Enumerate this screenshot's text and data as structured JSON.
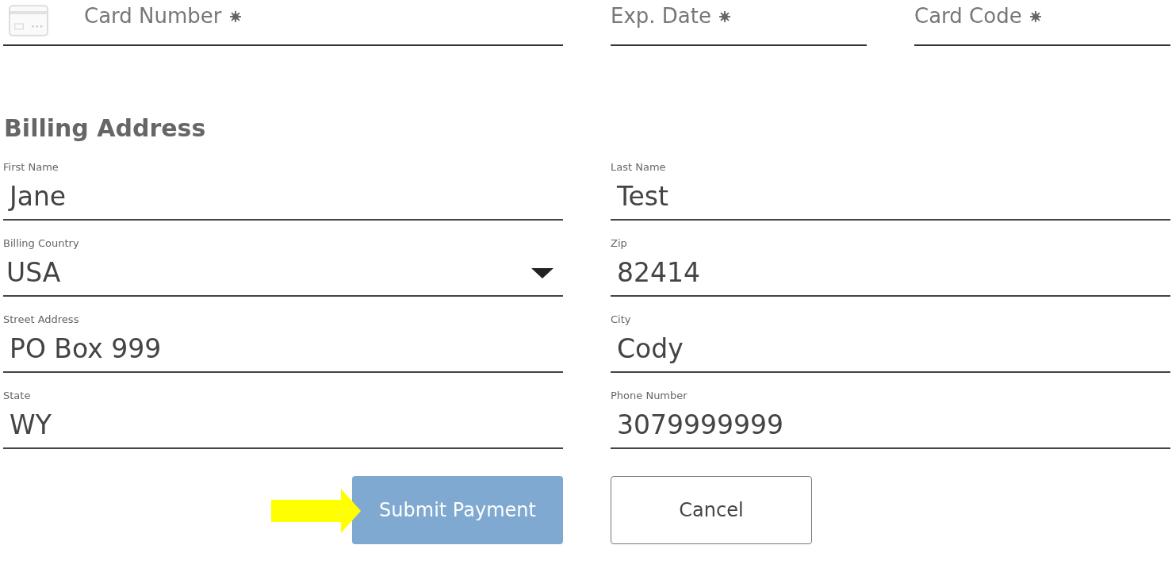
{
  "card_fields": [
    {
      "placeholder": "Card Number",
      "required": true
    },
    {
      "placeholder": "Exp. Date",
      "required": true
    },
    {
      "placeholder": "Card Code",
      "required": true
    }
  ],
  "billing": {
    "title": "Billing Address",
    "fields": [
      {
        "label": "First Name",
        "value": "Jane",
        "kind": "text"
      },
      {
        "label": "Last Name",
        "value": "Test",
        "kind": "text"
      },
      {
        "label": "Billing Country",
        "value": "USA",
        "kind": "select"
      },
      {
        "label": "Zip",
        "value": "82414",
        "kind": "text"
      },
      {
        "label": "Street Address",
        "value": "PO Box 999",
        "kind": "text"
      },
      {
        "label": "City",
        "value": "Cody",
        "kind": "text"
      },
      {
        "label": "State",
        "value": "WY",
        "kind": "text"
      },
      {
        "label": "Phone Number",
        "value": "3079999999",
        "kind": "text"
      }
    ]
  },
  "buttons": [
    {
      "label": "Submit Payment",
      "kind": "primary",
      "pointer_arrow": true
    },
    {
      "label": "Cancel",
      "kind": "secondary"
    }
  ]
}
